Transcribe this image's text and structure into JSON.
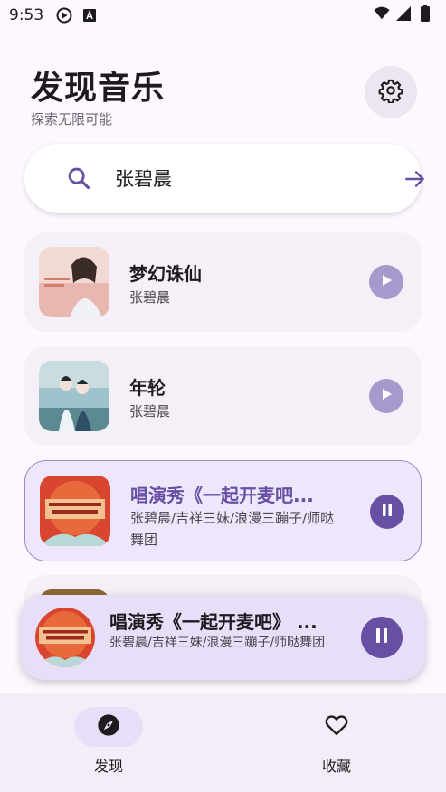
{
  "status_bar": {
    "time": "9:53",
    "left_icons": [
      "play-circle-icon",
      "font-icon"
    ],
    "right_icons": [
      "wifi-icon",
      "signal-icon",
      "battery-icon"
    ]
  },
  "header": {
    "title": "发现音乐",
    "subtitle": "探索无限可能",
    "settings_icon": "gear-icon"
  },
  "search": {
    "value": "张碧晨",
    "icon": "search-icon",
    "submit_icon": "arrow-right-icon"
  },
  "songs": [
    {
      "title": "梦幻诛仙",
      "artist": "张碧晨",
      "state": "play"
    },
    {
      "title": "年轮",
      "artist": "张碧晨",
      "state": "play"
    },
    {
      "title": "唱演秀《一起开麦吧...",
      "artist": "张碧晨/吉祥三妹/浪漫三蹦子/师哒舞团",
      "state": "playing"
    }
  ],
  "now_playing": {
    "title": "唱演秀《一起开麦吧》 ...",
    "artist": "张碧晨/吉祥三妹/浪漫三蹦子/师哒舞团",
    "state": "playing"
  },
  "bottom_nav": [
    {
      "label": "发现",
      "icon": "compass-icon",
      "active": true
    },
    {
      "label": "收藏",
      "icon": "heart-icon",
      "active": false
    }
  ],
  "colors": {
    "accent": "#6750a4",
    "accent_light": "#a699cc",
    "background": "#fdf7ff",
    "card": "#f5eff7",
    "active_card": "#eee6fb"
  }
}
